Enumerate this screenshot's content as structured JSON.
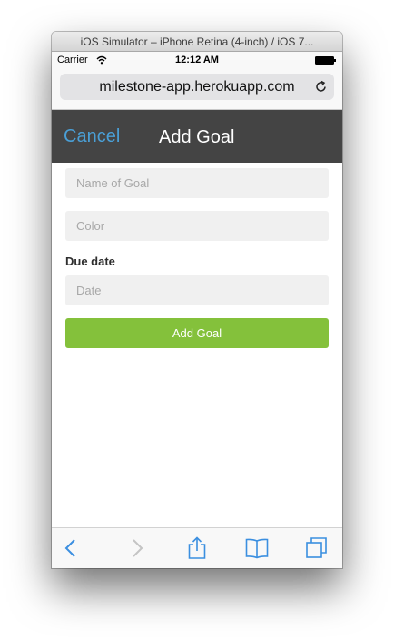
{
  "window": {
    "title": "iOS Simulator – iPhone Retina (4-inch) / iOS 7..."
  },
  "status_bar": {
    "carrier": "Carrier",
    "time": "12:12 AM"
  },
  "browser": {
    "url": "milestone-app.herokuapp.com"
  },
  "header": {
    "cancel_label": "Cancel",
    "title": "Add Goal"
  },
  "form": {
    "name_placeholder": "Name of Goal",
    "color_placeholder": "Color",
    "due_date_label": "Due date",
    "date_placeholder": "Date",
    "submit_label": "Add Goal"
  },
  "colors": {
    "header_bg": "#444444",
    "accent_blue": "#4a9fd6",
    "submit_green": "#84c13b",
    "toolbar_icon": "#3b8fe0"
  },
  "toolbar": {
    "icons": [
      "back-icon",
      "forward-icon",
      "share-icon",
      "bookmarks-icon",
      "tabs-icon"
    ]
  }
}
